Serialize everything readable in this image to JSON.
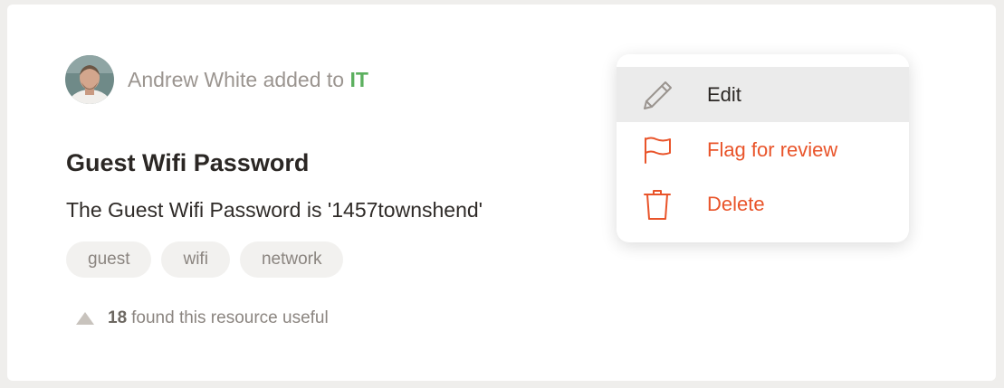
{
  "activity": {
    "author": "Andrew White",
    "action": "added to",
    "team": "IT"
  },
  "resource": {
    "title": "Guest Wifi Password",
    "description": "The Guest Wifi Password is '1457townshend'",
    "tags": [
      "guest",
      "wifi",
      "network"
    ]
  },
  "votes": {
    "count": "18",
    "text": "found this resource useful"
  },
  "menu": {
    "edit_label": "Edit",
    "flag_label": "Flag for review",
    "delete_label": "Delete"
  },
  "colors": {
    "team_accent": "#5cb05f",
    "danger": "#e9542a",
    "menu_hover": "#ebebeb"
  },
  "icons": {
    "upvote": "triangle-up-icon",
    "edit": "pencil-icon",
    "flag": "flag-icon",
    "delete": "trash-icon"
  }
}
